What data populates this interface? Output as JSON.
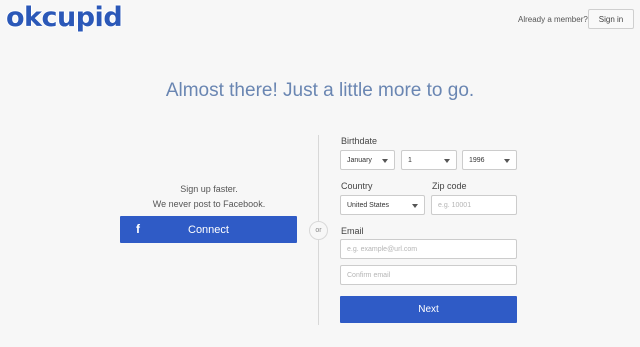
{
  "header": {
    "logo": "okcupid",
    "already_member": "Already a member?",
    "sign_in": "Sign in"
  },
  "headline": "Almost there! Just a little more to go.",
  "facebook": {
    "line1": "Sign up faster.",
    "line2": "We never post to Facebook.",
    "icon": "f",
    "button": "Connect"
  },
  "or_label": "or",
  "form": {
    "birthdate_label": "Birthdate",
    "month": "January",
    "day": "1",
    "year": "1996",
    "country_label": "Country",
    "country": "United States",
    "zip_label": "Zip code",
    "zip_placeholder": "e.g. 10001",
    "email_label": "Email",
    "email_placeholder": "e.g. example@url.com",
    "confirm_placeholder": "Confirm email",
    "next": "Next"
  },
  "colors": {
    "brand": "#2b58b8",
    "button": "#2f5bc6",
    "headline": "#6a86b2"
  }
}
